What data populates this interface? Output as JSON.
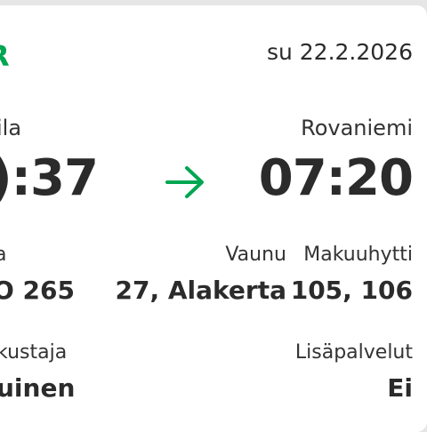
{
  "header": {
    "logo_text": "R",
    "date": "su 22.2.2026",
    "brand_color": "#00a651"
  },
  "departure": {
    "station": "ila",
    "time": "):37"
  },
  "arrival": {
    "station": "Rovaniemi",
    "time": "07:20"
  },
  "arrow_icon": "arrow-right-icon",
  "details": {
    "train_label": "a",
    "train_value": "O 265",
    "car_label": "Vaunu",
    "car_value": "27, Alakerta",
    "cabin_label": "Makuuhytti",
    "cabin_value": "105, 106",
    "traveller_label": "kustaja",
    "traveller_value": "uinen",
    "services_label": "Lisäpalvelut",
    "services_value": "Ei"
  }
}
